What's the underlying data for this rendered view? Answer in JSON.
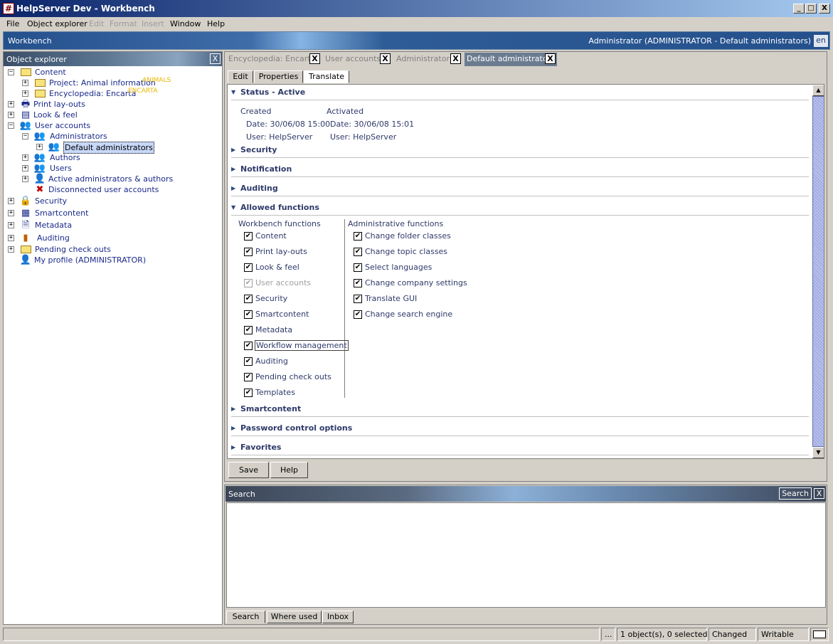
{
  "window": {
    "title": "HelpServer Dev - Workbench",
    "controls": {
      "minimize": "_",
      "maximize": "□",
      "close": "X"
    }
  },
  "menubar": {
    "items": [
      {
        "label": "File",
        "enabled": true
      },
      {
        "label": "Object explorer",
        "enabled": true
      },
      {
        "label": "Edit",
        "enabled": false
      },
      {
        "label": "Format",
        "enabled": false
      },
      {
        "label": "Insert",
        "enabled": false
      },
      {
        "label": "Window",
        "enabled": true
      },
      {
        "label": "Help",
        "enabled": true
      }
    ]
  },
  "workbench": {
    "title": "Workbench",
    "user": "Administrator (ADMINISTRATOR - Default administrators)",
    "language": "en"
  },
  "explorer": {
    "title": "Object explorer",
    "close": "X",
    "tree": [
      {
        "label": "Content",
        "expander": "−",
        "icon": "folder-icon"
      },
      {
        "label": "Project: Animal information",
        "tag": "ANIMALS",
        "expander": "+",
        "icon": "project-folder-icon"
      },
      {
        "label": "Encyclopedia: Encarta",
        "tag": "ENCARTA",
        "expander": "+",
        "icon": "folder-icon"
      },
      {
        "label": "Print lay-outs",
        "expander": "+",
        "icon": "printer-icon"
      },
      {
        "label": "Look & feel",
        "expander": "+",
        "icon": "monitor-icon"
      },
      {
        "label": "User accounts",
        "expander": "−",
        "icon": "users-icon"
      },
      {
        "label": "Administrators",
        "expander": "−",
        "icon": "users-icon"
      },
      {
        "label": "Default administrators",
        "expander": "+",
        "icon": "users-icon",
        "selected": true
      },
      {
        "label": "Authors",
        "expander": "+",
        "icon": "users-icon"
      },
      {
        "label": "Users",
        "expander": "+",
        "icon": "users-icon"
      },
      {
        "label": "Active administrators & authors",
        "expander": "+",
        "icon": "active-user-icon"
      },
      {
        "label": "Disconnected user accounts",
        "expander": "",
        "icon": "disconnected-user-icon"
      },
      {
        "label": "Security",
        "expander": "+",
        "icon": "lock-icon"
      },
      {
        "label": "Smartcontent",
        "expander": "+",
        "icon": "smartcontent-icon"
      },
      {
        "label": "Metadata",
        "expander": "+",
        "icon": "metadata-icon"
      },
      {
        "label": "Auditing",
        "expander": "+",
        "icon": "chart-icon"
      },
      {
        "label": "Pending check outs",
        "expander": "+",
        "icon": "checkout-icon"
      },
      {
        "label": "My profile (ADMINISTRATOR)",
        "expander": "",
        "icon": "profile-icon"
      }
    ]
  },
  "editor": {
    "doc_tabs": [
      {
        "label": "Encyclopedia: Encarta",
        "close": "X"
      },
      {
        "label": "User accounts",
        "close": "X"
      },
      {
        "label": "Administrators",
        "close": "X"
      },
      {
        "label": "Default administrators",
        "close": "X",
        "active": true
      }
    ],
    "sub_tabs": [
      "Edit",
      "Properties",
      "Translate"
    ],
    "active_sub_tab": "Translate",
    "status": {
      "title": "Status - Active",
      "created_label": "Created",
      "activated_label": "Activated",
      "created_date": "Date:  30/06/08 15:00",
      "created_user": "User:  HelpServer",
      "activated_date": "Date:  30/06/08 15:01",
      "activated_user": "User:  HelpServer"
    },
    "sections": {
      "security": "Security",
      "notification": "Notification",
      "auditing": "Auditing",
      "allowed_functions": "Allowed functions",
      "smartcontent": "Smartcontent",
      "password_control": "Password control options",
      "favorites": "Favorites"
    },
    "workbench_functions_header": "Workbench functions",
    "administrative_functions_header": "Administrative functions",
    "workbench_functions": [
      {
        "label": "Content",
        "checked": true,
        "enabled": true
      },
      {
        "label": "Print lay-outs",
        "checked": true,
        "enabled": true
      },
      {
        "label": "Look & feel",
        "checked": true,
        "enabled": true
      },
      {
        "label": "User accounts",
        "checked": true,
        "enabled": false
      },
      {
        "label": "Security",
        "checked": true,
        "enabled": true
      },
      {
        "label": "Smartcontent",
        "checked": true,
        "enabled": true
      },
      {
        "label": "Metadata",
        "checked": true,
        "enabled": true
      },
      {
        "label": "Workflow management",
        "checked": true,
        "enabled": true,
        "focused": true
      },
      {
        "label": "Auditing",
        "checked": true,
        "enabled": true
      },
      {
        "label": "Pending check outs",
        "checked": true,
        "enabled": true
      },
      {
        "label": "Templates",
        "checked": true,
        "enabled": true
      }
    ],
    "administrative_functions": [
      {
        "label": "Change folder classes",
        "checked": true
      },
      {
        "label": "Change topic classes",
        "checked": true
      },
      {
        "label": "Select languages",
        "checked": true
      },
      {
        "label": "Change company settings",
        "checked": true
      },
      {
        "label": "Translate GUI",
        "checked": true
      },
      {
        "label": "Change search engine",
        "checked": true
      }
    ],
    "save_label": "Save",
    "help_label": "Help"
  },
  "search": {
    "title": "Search",
    "button_label": "Search",
    "close": "X",
    "tabs": [
      "Search",
      "Where used",
      "Inbox"
    ]
  },
  "statusbar": {
    "ellipsis": "...",
    "selection": "1 object(s), 0 selected",
    "changed": "Changed",
    "writable": "Writable"
  }
}
